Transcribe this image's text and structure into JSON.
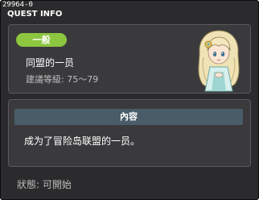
{
  "window": {
    "quest_id": "29964-0",
    "title": "QUEST INFO"
  },
  "quest": {
    "badge": "一般",
    "name": "同盟的一员",
    "level_text": "建議等級: 75～79",
    "npc_icon": "npc-portrait-icon"
  },
  "content": {
    "header": "內容",
    "text": "成为了冒险岛联盟的一员。"
  },
  "footer": {
    "status": "狀態: 可開始"
  },
  "colors": {
    "window_bg": "#2b2b2d",
    "panel_bg": "#3a3a3d",
    "badge_green": "#8dc63f",
    "header_bar": "#4a5c68",
    "muted_text": "#bdbdbd"
  }
}
